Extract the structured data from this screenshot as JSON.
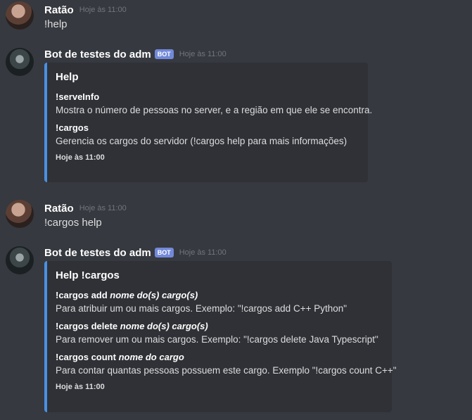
{
  "messages": [
    {
      "author": "Ratão",
      "time": "Hoje às 11:00",
      "text": "!help"
    },
    {
      "author": "Bot de testes do adm",
      "badge": "BOT",
      "time": "Hoje às 11:00",
      "embed": {
        "title": "Help",
        "accent_color": "#4a90e2",
        "fields": [
          {
            "name": "!serveInfo",
            "value": "Mostra o número de pessoas no server, e a região em que ele se encontra."
          },
          {
            "name": "!cargos",
            "value": "Gerencia os cargos do servidor (!cargos help para mais informações)"
          }
        ],
        "footer": "Hoje às 11:00"
      }
    },
    {
      "author": "Ratão",
      "time": "Hoje às 11:00",
      "text": "!cargos help"
    },
    {
      "author": "Bot de testes do adm",
      "badge": "BOT",
      "time": "Hoje às 11:00",
      "embed": {
        "title": "Help !cargos",
        "accent_color": "#4a90e2",
        "fields": [
          {
            "name_cmd": "!cargos add ",
            "name_arg": "nome do(s) cargo(s)",
            "value": "Para atribuir um ou mais cargos. Exemplo: \"!cargos add C++ Python\""
          },
          {
            "name_cmd": "!cargos delete ",
            "name_arg": "nome do(s) cargo(s)",
            "value": "Para remover um ou mais cargos. Exemplo: \"!cargos delete Java Typescript\""
          },
          {
            "name_cmd": "!cargos count ",
            "name_arg": "nome do cargo",
            "value": "Para contar quantas pessoas possuem este cargo. Exemplo \"!cargos count C++\""
          }
        ],
        "footer": "Hoje às 11:00"
      }
    }
  ],
  "colors": {
    "background": "#36393f",
    "embed_bg": "#2f3136",
    "badge": "#7289da"
  }
}
